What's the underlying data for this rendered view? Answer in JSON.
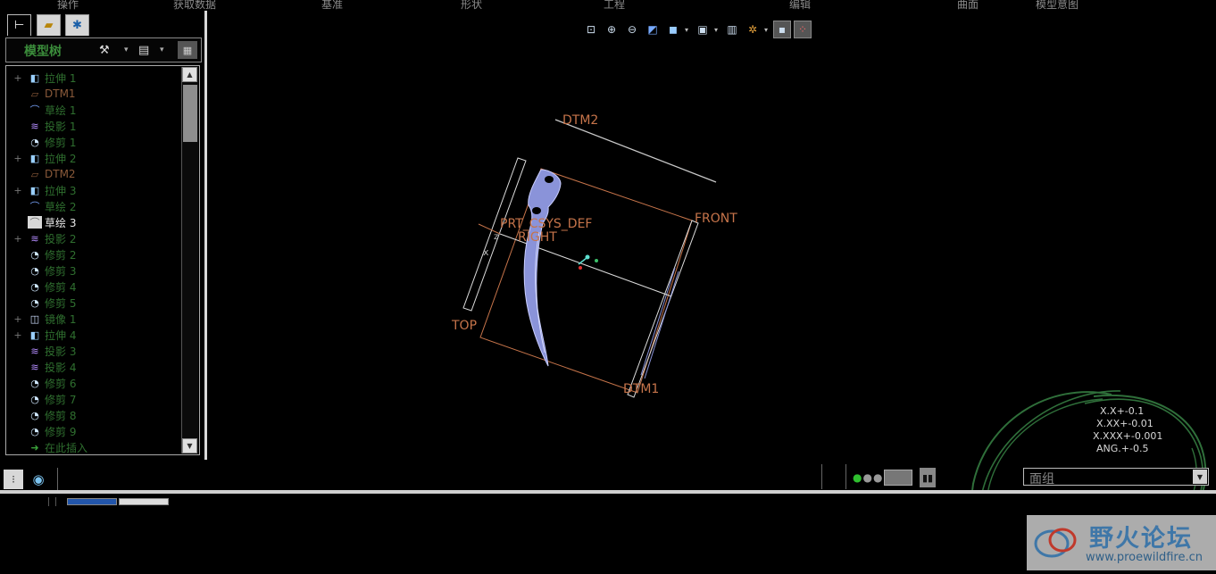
{
  "menu": [
    "操作",
    "获取数据",
    "基准",
    "形状",
    "工程",
    "编辑",
    "曲面",
    "模型意图"
  ],
  "model_tree": {
    "title": "模型树",
    "items": [
      {
        "label": "拉伸 1",
        "icon": "extrude-icon",
        "expandable": true
      },
      {
        "label": "DTM1",
        "icon": "datum-plane-icon",
        "expandable": false
      },
      {
        "label": "草绘 1",
        "icon": "sketch-icon",
        "expandable": false
      },
      {
        "label": "投影 1",
        "icon": "projection-icon",
        "expandable": false
      },
      {
        "label": "修剪 1",
        "icon": "trim-icon",
        "expandable": false
      },
      {
        "label": "拉伸 2",
        "icon": "extrude-icon",
        "expandable": true
      },
      {
        "label": "DTM2",
        "icon": "datum-plane-icon",
        "expandable": false
      },
      {
        "label": "拉伸 3",
        "icon": "extrude-icon",
        "expandable": true
      },
      {
        "label": "草绘 2",
        "icon": "sketch-icon",
        "expandable": false
      },
      {
        "label": "草绘 3",
        "icon": "sketch-icon",
        "expandable": false,
        "selected": true
      },
      {
        "label": "投影 2",
        "icon": "projection-icon",
        "expandable": true
      },
      {
        "label": "修剪 2",
        "icon": "trim-icon",
        "expandable": false
      },
      {
        "label": "修剪 3",
        "icon": "trim-icon",
        "expandable": false
      },
      {
        "label": "修剪 4",
        "icon": "trim-icon",
        "expandable": false
      },
      {
        "label": "修剪 5",
        "icon": "trim-icon",
        "expandable": false
      },
      {
        "label": "镜像 1",
        "icon": "mirror-icon",
        "expandable": true
      },
      {
        "label": "拉伸 4",
        "icon": "extrude-icon",
        "expandable": true
      },
      {
        "label": "投影 3",
        "icon": "projection-icon",
        "expandable": false
      },
      {
        "label": "投影 4",
        "icon": "projection-icon",
        "expandable": false
      },
      {
        "label": "修剪 6",
        "icon": "trim-icon",
        "expandable": false
      },
      {
        "label": "修剪 7",
        "icon": "trim-icon",
        "expandable": false
      },
      {
        "label": "修剪 8",
        "icon": "trim-icon",
        "expandable": false
      },
      {
        "label": "修剪 9",
        "icon": "trim-icon",
        "expandable": false
      },
      {
        "label": "在此插入",
        "icon": "insert-arrow-icon",
        "expandable": false
      }
    ]
  },
  "viewport": {
    "datums": {
      "dtm2": "DTM2",
      "front": "FRONT",
      "csys": "PRT_CSYS_DEF",
      "right": "RIGHT",
      "top": "TOP",
      "dtm1": "DTM1"
    },
    "tolerances": [
      "X.X+-0.1",
      "X.XX+-0.01",
      "X.XXX+-0.001",
      "ANG.+-0.5"
    ]
  },
  "filter": {
    "value": "面组"
  },
  "watermark": {
    "title": "野火论坛",
    "url": "www.proewildfire.cn"
  },
  "colors": {
    "feature_green": "#2f6f2f",
    "datum_orange": "#c6744a",
    "part_blue": "#8a93d9",
    "background": "#000000"
  }
}
